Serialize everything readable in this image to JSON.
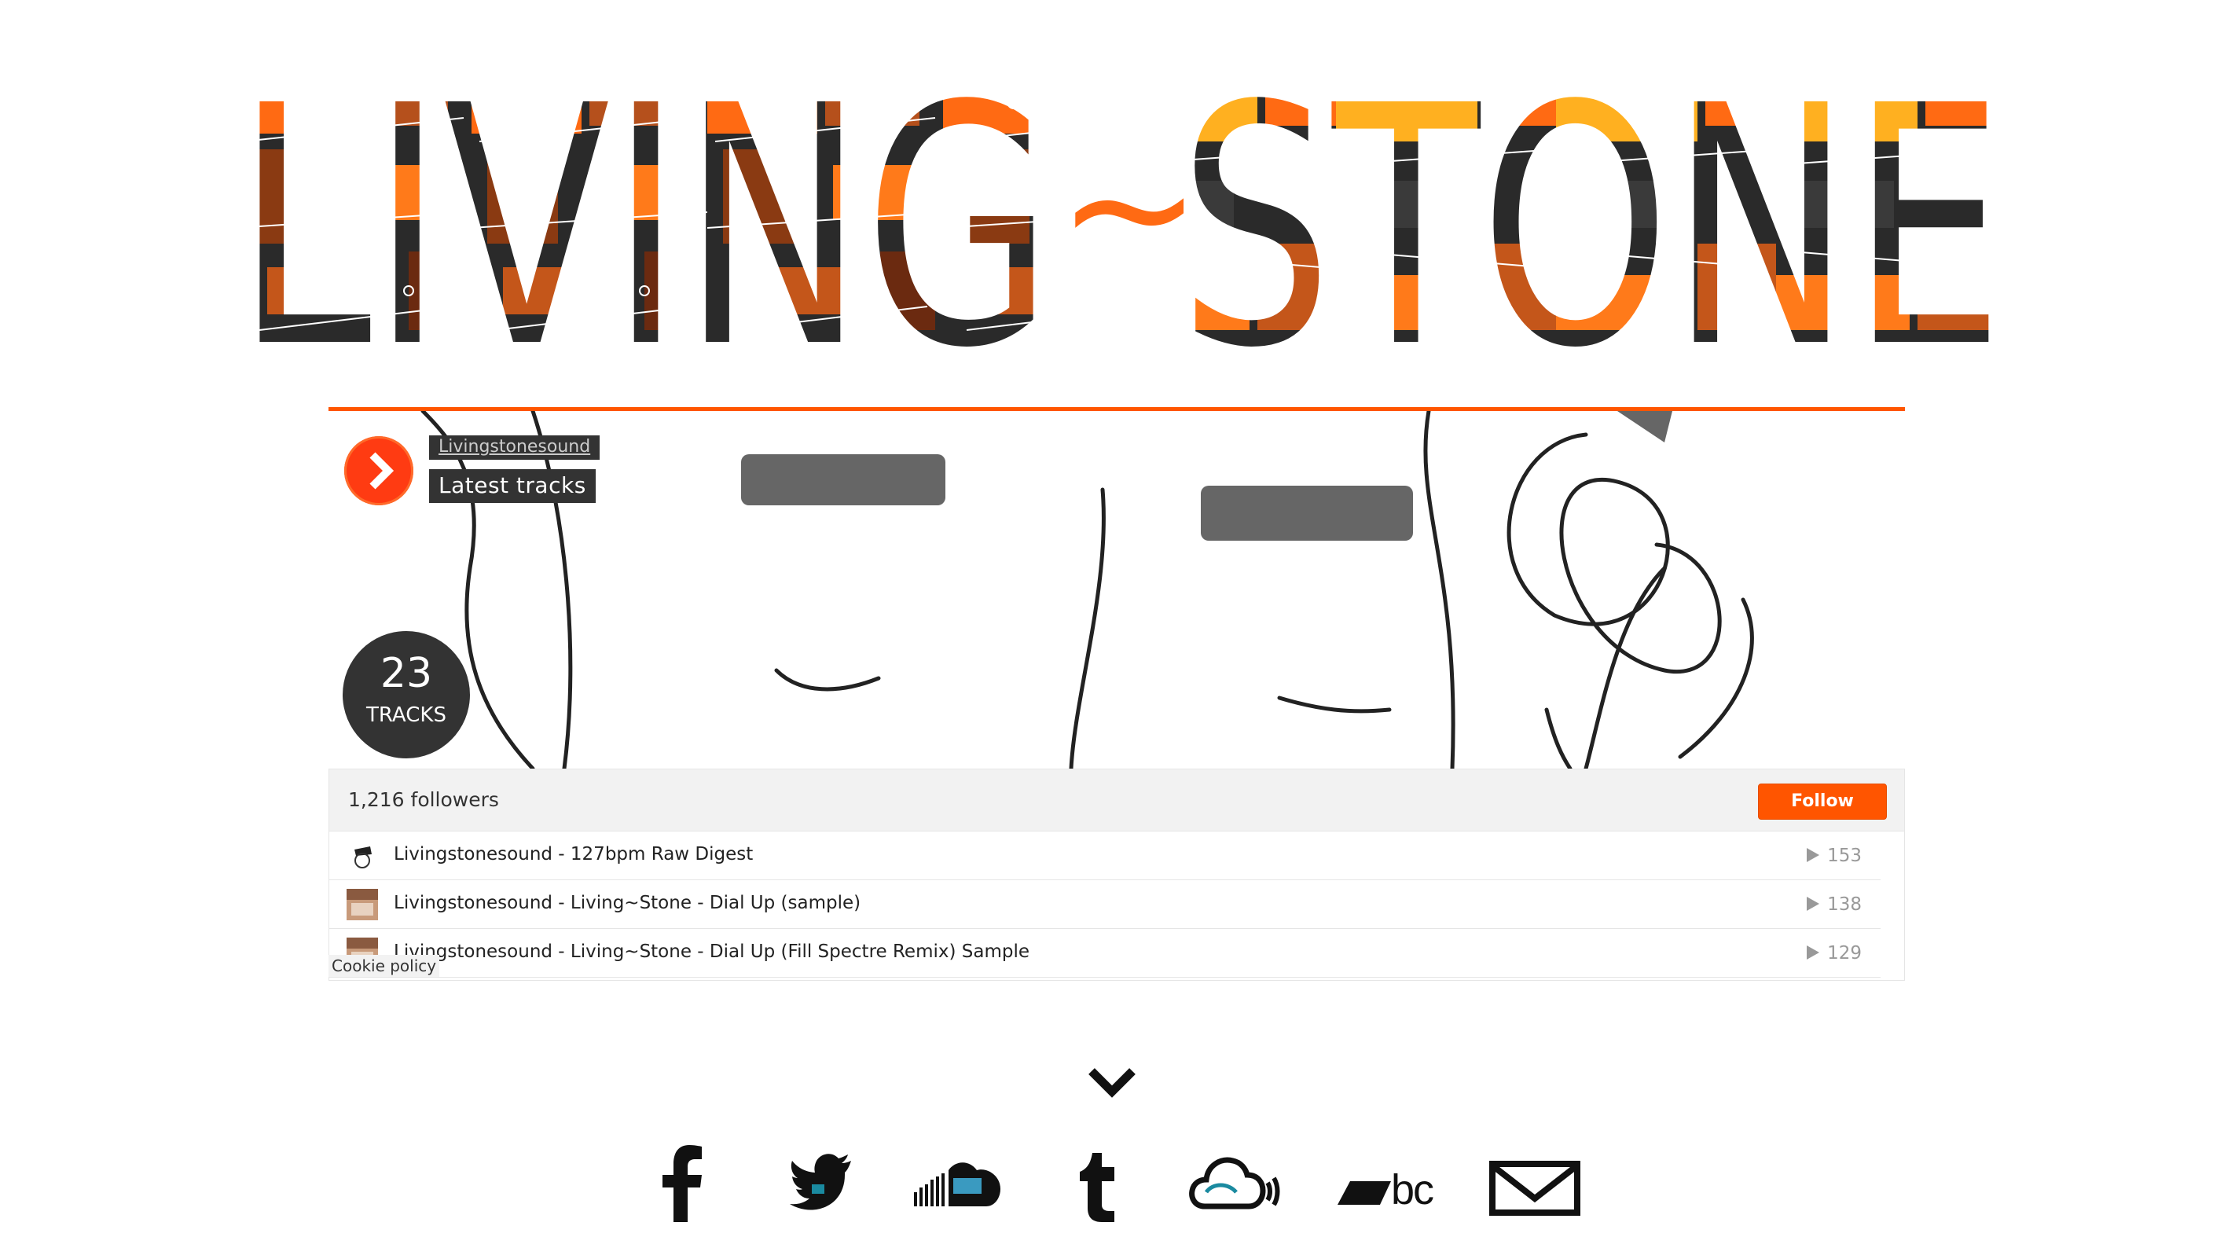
{
  "logo": {
    "text_left": "LIVING",
    "separator": "~",
    "text_right": "STONE"
  },
  "widget": {
    "username": "Livingstonesound",
    "set_title": "Latest tracks",
    "tracks_count": "23",
    "tracks_label": "TRACKS",
    "followers": "1,216 followers",
    "follow_label": "Follow",
    "tracks": [
      {
        "title": "Livingstonesound - 127bpm Raw Digest",
        "plays": "153"
      },
      {
        "title": "Livingstonesound - Living~Stone - Dial Up (sample)",
        "plays": "138"
      },
      {
        "title": "Livingstonesound - Living~Stone - Dial Up (Fill Spectre Remix) Sample",
        "plays": "129"
      }
    ]
  },
  "cookie_policy": "Cookie policy",
  "social_links": [
    "facebook-icon",
    "twitter-icon",
    "soundcloud-icon",
    "tumblr-icon",
    "mixcloud-icon",
    "bandcamp-icon",
    "email-icon"
  ],
  "bandcamp_text": "bc",
  "colors": {
    "accent": "#ff5500",
    "dark": "#333333",
    "logo_orange": "#ff6a13",
    "logo_yellow": "#ffb020",
    "logo_brown": "#8a3a12"
  }
}
